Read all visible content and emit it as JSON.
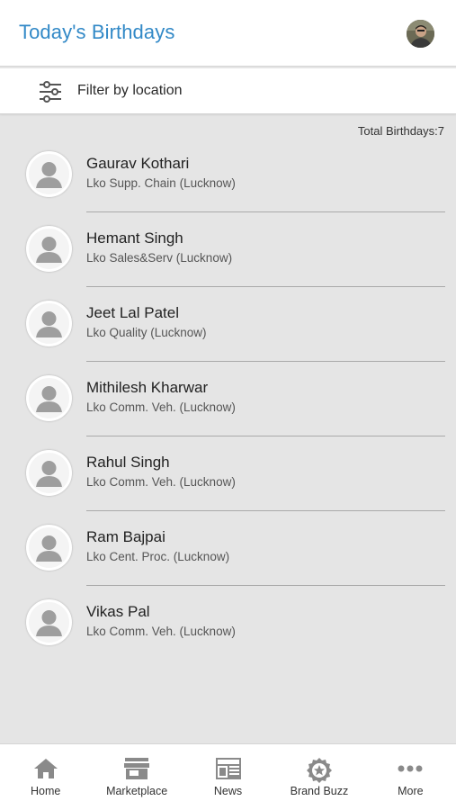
{
  "header": {
    "title": "Today's Birthdays"
  },
  "filter": {
    "label": "Filter by location"
  },
  "summary": {
    "total_text": "Total Birthdays:7"
  },
  "birthdays": [
    {
      "name": "Gaurav Kothari",
      "dept": "Lko Supp. Chain (Lucknow)"
    },
    {
      "name": "Hemant Singh",
      "dept": "Lko Sales&Serv (Lucknow)"
    },
    {
      "name": "Jeet Lal Patel",
      "dept": "Lko Quality (Lucknow)"
    },
    {
      "name": "Mithilesh Kharwar",
      "dept": "Lko Comm. Veh. (Lucknow)"
    },
    {
      "name": "Rahul Singh",
      "dept": "Lko Comm. Veh. (Lucknow)"
    },
    {
      "name": "Ram Bajpai",
      "dept": "Lko Cent. Proc. (Lucknow)"
    },
    {
      "name": "Vikas Pal",
      "dept": "Lko Comm. Veh. (Lucknow)"
    }
  ],
  "nav": [
    {
      "label": "Home",
      "icon": "home-icon"
    },
    {
      "label": "Marketplace",
      "icon": "store-icon"
    },
    {
      "label": "News",
      "icon": "newspaper-icon"
    },
    {
      "label": "Brand Buzz",
      "icon": "badge-star-icon"
    },
    {
      "label": "More",
      "icon": "more-dots-icon"
    }
  ],
  "colors": {
    "title": "#3289c7",
    "background": "#e5e5e5",
    "icon": "#8a8a8a"
  }
}
